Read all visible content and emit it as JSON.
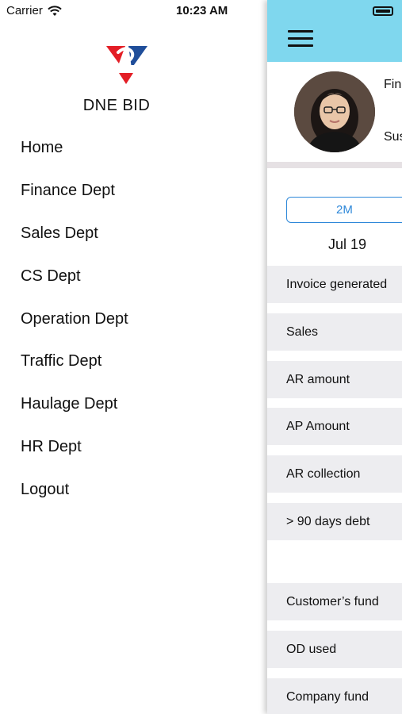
{
  "status_bar": {
    "carrier": "Carrier",
    "time": "10:23 AM"
  },
  "sidebar": {
    "brand": "DNE BID",
    "menu": [
      "Home",
      "Finance Dept",
      "Sales Dept",
      "CS Dept",
      "Operation Dept",
      "Traffic Dept",
      "Haulage Dept",
      "HR Dept",
      "Logout"
    ]
  },
  "main": {
    "profile": {
      "name_partial": "Fin",
      "subtitle_partial": "Sus"
    },
    "period_selected": "2M",
    "date": "Jul 19",
    "metrics": [
      "Invoice generated",
      "Sales",
      "AR amount",
      "AP Amount",
      "AR collection",
      "> 90 days debt",
      "Customer’s fund",
      "OD used",
      "Company fund"
    ]
  },
  "colors": {
    "header": "#7fd7ee",
    "accent": "#2e88d9",
    "logo_red": "#e31e26",
    "logo_blue": "#1f4e9a"
  }
}
